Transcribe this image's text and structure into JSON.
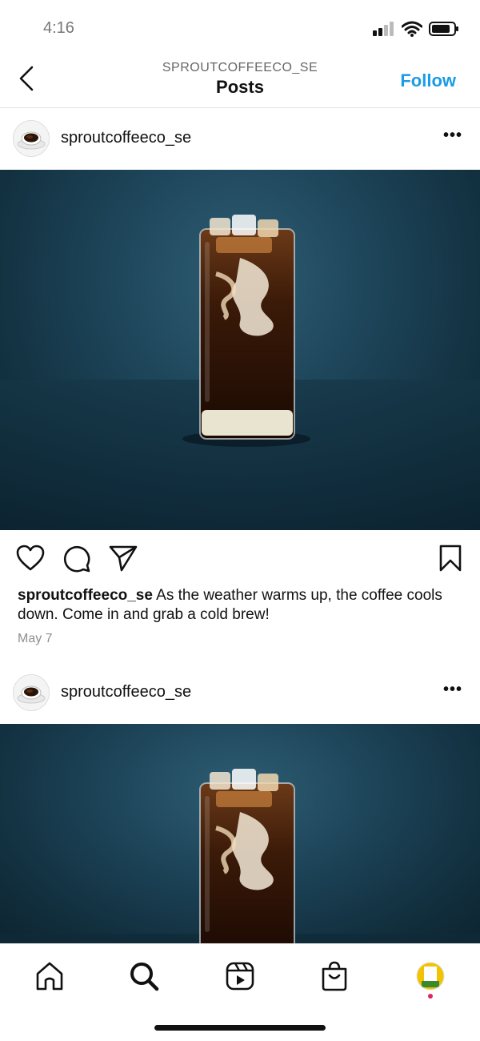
{
  "status": {
    "time": "4:16"
  },
  "header": {
    "subtitle": "SPROUTCOFFEECO_SE",
    "title": "Posts",
    "follow_label": "Follow"
  },
  "posts": [
    {
      "username": "sproutcoffeeco_se",
      "caption_user": "sproutcoffeeco_se",
      "caption_text": " As the weather warms up, the coffee cools down. Come in and grab a cold brew!",
      "date": "May 7"
    },
    {
      "username": "sproutcoffeeco_se"
    }
  ],
  "icons": {
    "back": "chevron-left-icon",
    "more": "more-horizontal-icon",
    "like": "heart-icon",
    "comment": "comment-icon",
    "share": "send-icon",
    "save": "bookmark-icon",
    "tabs": [
      "home-icon",
      "search-icon",
      "reels-icon",
      "shop-icon",
      "profile-avatar"
    ]
  },
  "colors": {
    "accent": "#1a9be6",
    "notification_dot": "#e0245e"
  }
}
